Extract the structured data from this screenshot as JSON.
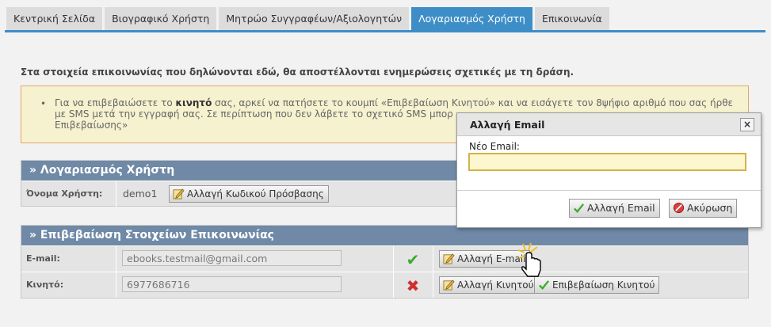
{
  "tabs": [
    {
      "label": "Κεντρική Σελίδα",
      "active": false
    },
    {
      "label": "Βιογραφικό Χρήστη",
      "active": false
    },
    {
      "label": "Μητρώο Συγγραφέων/Αξιολογητών",
      "active": false
    },
    {
      "label": "Λογαριασμός Χρήστη",
      "active": true
    },
    {
      "label": "Επικοινωνία",
      "active": false
    }
  ],
  "intro": "Στα στοιχεία επικοινωνίας που δηλώνονται εδώ, θα αποστέλλονται ενημερώσεις σχετικές με τη δράση.",
  "notice": {
    "bullet": "•",
    "text_before": "Για να επιβεβαιώσετε το ",
    "bold": "κινητό",
    "text_after": " σας, αρκεί να πατήσετε το κουμπί «Επιβεβαίωση Κινητού» και να εισάγετε τον 8ψήφιο αριθμό που σας ήρθε με SMS μετά την εγγραφή σας. Σε περίπτωση που δεν λάβετε το σχετικό SMS μπορ",
    "line3": "Επιβεβαίωσης»"
  },
  "account_panel": {
    "title": "» Λογαριασμός Χρήστη",
    "username_label": "Όνομα Χρήστη:",
    "username": "demo1",
    "change_password": "Αλλαγή Κωδικού Πρόσβασης"
  },
  "contact_panel": {
    "title": "» Επιβεβαίωση Στοιχείων Επικοινωνίας",
    "email_label": "E-mail:",
    "email": "ebooks.testmail@gmail.com",
    "email_status": "✔",
    "change_email": "Αλλαγή E-mail",
    "mobile_label": "Κινητό:",
    "mobile": "6977686716",
    "mobile_status": "✖",
    "change_mobile": "Αλλαγή Κινητού",
    "confirm_mobile": "Επιβεβαίωση Κινητού"
  },
  "dialog": {
    "title": "Αλλαγή Email",
    "close": "×",
    "field_label": "Νέο Email:",
    "field_value": "",
    "ok_button": "Αλλαγή Email",
    "cancel_button": "Ακύρωση"
  },
  "colors": {
    "accent": "#3d8ec7",
    "panel_head": "#6f89a7",
    "ok": "#3bab2c",
    "error": "#d03030"
  }
}
